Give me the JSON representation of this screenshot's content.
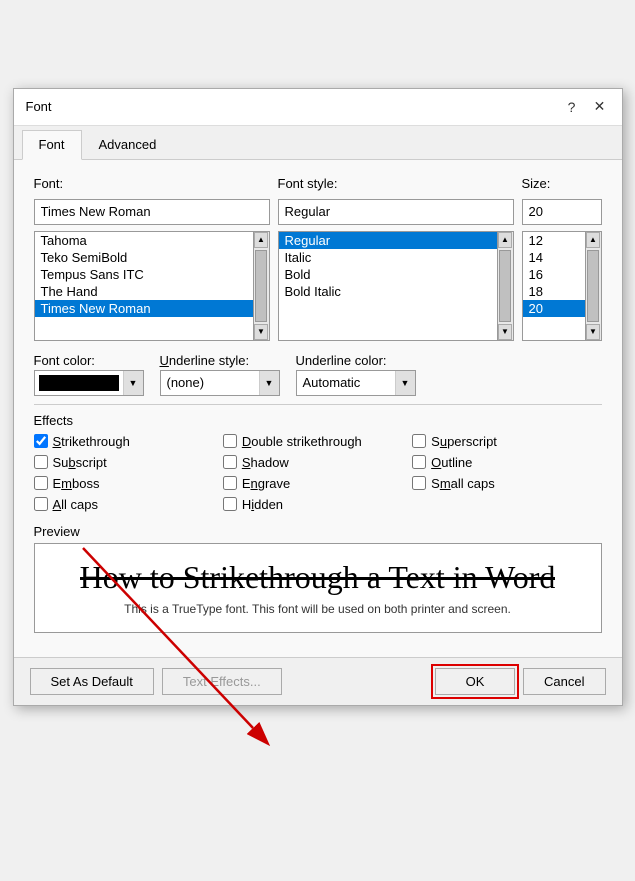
{
  "dialog": {
    "title": "Font",
    "help_btn": "?",
    "close_btn": "✕"
  },
  "tabs": [
    {
      "label": "Font",
      "active": true
    },
    {
      "label": "Advanced",
      "active": false
    }
  ],
  "font_section": {
    "font_label": "Font:",
    "style_label": "Font style:",
    "size_label": "Size:",
    "font_value": "Times New Roman",
    "style_value": "Regular",
    "size_value": "20",
    "font_list": [
      {
        "label": "Tahoma",
        "selected": false
      },
      {
        "label": "Teko SemiBold",
        "selected": false
      },
      {
        "label": "Tempus Sans ITC",
        "selected": false
      },
      {
        "label": "The Hand",
        "selected": false
      },
      {
        "label": "Times New Roman",
        "selected": true
      }
    ],
    "style_list": [
      {
        "label": "Regular",
        "selected": true
      },
      {
        "label": "Italic",
        "selected": false
      },
      {
        "label": "Bold",
        "selected": false
      },
      {
        "label": "Bold Italic",
        "selected": false
      }
    ],
    "size_list": [
      {
        "label": "12",
        "selected": false
      },
      {
        "label": "14",
        "selected": false
      },
      {
        "label": "16",
        "selected": false
      },
      {
        "label": "18",
        "selected": false
      },
      {
        "label": "20",
        "selected": true
      }
    ]
  },
  "color_section": {
    "font_color_label": "Font color:",
    "underline_style_label": "Underline style:",
    "underline_color_label": "Underline color:",
    "font_color_value": "Black",
    "underline_style_value": "(none)",
    "underline_color_value": "Automatic"
  },
  "effects": {
    "title": "Effects",
    "items": [
      {
        "label": "Strikethrough",
        "checked": true,
        "underline_char": "S"
      },
      {
        "label": "Double strikethrough",
        "checked": false,
        "underline_char": "D"
      },
      {
        "label": "Superscript",
        "checked": false,
        "underline_char": "u"
      },
      {
        "label": "Subscript",
        "checked": false,
        "underline_char": "b"
      },
      {
        "label": "Shadow",
        "checked": false,
        "underline_char": "S"
      },
      {
        "label": "Outline",
        "checked": false,
        "underline_char": "O"
      },
      {
        "label": "Emboss",
        "checked": false,
        "underline_char": "m"
      },
      {
        "label": "Engrave",
        "checked": false,
        "underline_char": "n"
      },
      {
        "label": "Small caps",
        "checked": false,
        "underline_char": "m"
      },
      {
        "label": "All caps",
        "checked": false,
        "underline_char": "l"
      },
      {
        "label": "Hidden",
        "checked": false,
        "underline_char": "i"
      }
    ]
  },
  "preview": {
    "title": "Preview",
    "text": "How to Strikethrough a Text in Word",
    "subtext": "This is a TrueType font. This font will be used on both printer and screen."
  },
  "footer": {
    "set_default_label": "Set As Default",
    "text_effects_label": "Text Effects...",
    "ok_label": "OK",
    "cancel_label": "Cancel"
  }
}
